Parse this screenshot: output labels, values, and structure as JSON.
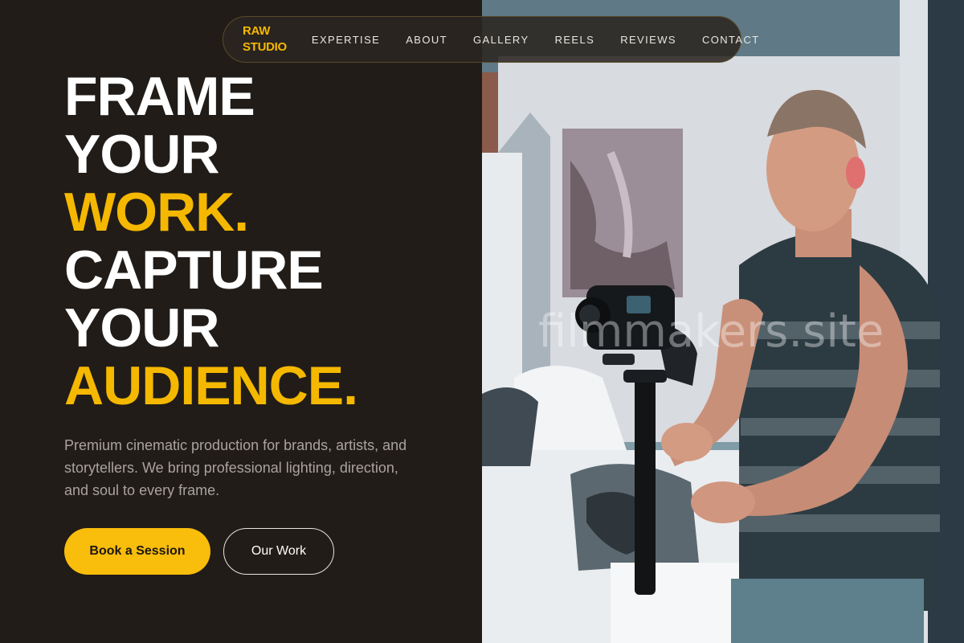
{
  "brand": {
    "line1": "RAW",
    "line2": "STUDIO",
    "accent_color": "#f5b800"
  },
  "nav": {
    "items": [
      {
        "label": "EXPERTISE"
      },
      {
        "label": "ABOUT"
      },
      {
        "label": "GALLERY"
      },
      {
        "label": "REELS"
      },
      {
        "label": "REVIEWS"
      },
      {
        "label": "CONTACT"
      }
    ]
  },
  "hero": {
    "lines": [
      {
        "text": "FRAME",
        "color": "#ffffff"
      },
      {
        "text": "YOUR",
        "color": "#ffffff"
      },
      {
        "text": "WORK.",
        "color": "#f5b800"
      },
      {
        "text": "CAPTURE",
        "color": "#ffffff"
      },
      {
        "text": "YOUR",
        "color": "#ffffff"
      },
      {
        "text": "AUDIENCE.",
        "color": "#f5b800"
      }
    ],
    "description": "Premium cinematic production for brands, artists, and storytellers. We bring professional lighting, direction, and soul to every frame.",
    "primary_button": "Book a Session",
    "secondary_button": "Our Work"
  },
  "photo": {
    "watermark": "filmmakers.site"
  },
  "colors": {
    "background": "#211c18",
    "accent": "#f9bd0b",
    "text_muted": "#a9a39c"
  }
}
